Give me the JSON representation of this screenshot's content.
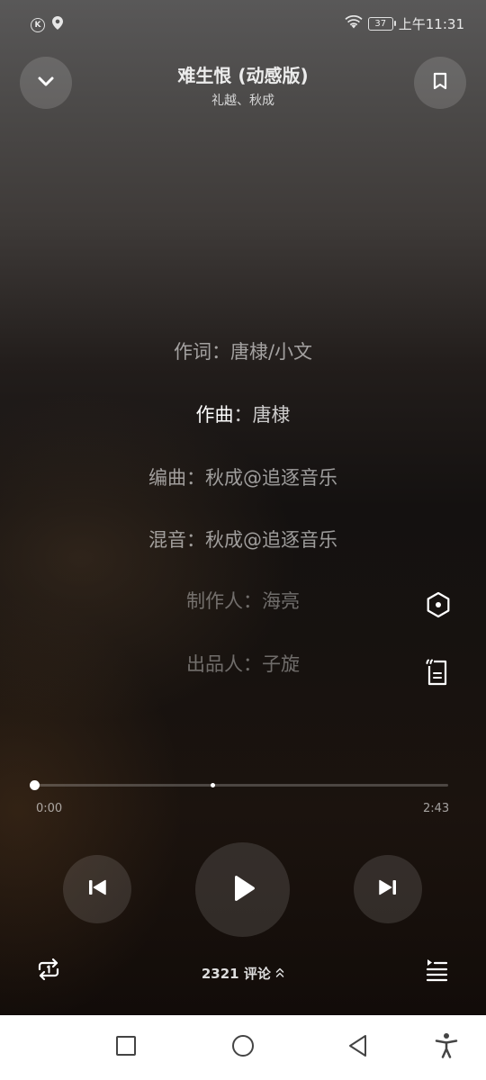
{
  "status_bar": {
    "time": "上午11:31",
    "battery": "37",
    "left_icons": [
      "k-badge-icon",
      "location-icon"
    ],
    "right_icons": [
      "wifi-icon",
      "battery-icon"
    ]
  },
  "header": {
    "title": "难生恨 (动感版)",
    "artist": "礼越、秋成",
    "collapse_icon": "chevron-down-icon",
    "bookmark_icon": "bookmark-icon"
  },
  "lyrics": [
    "作词：唐棣/小文",
    {
      "highlight": "作曲",
      "rest": "：唐棣"
    },
    "编曲：秋成@追逐音乐",
    "混音：秋成@追逐音乐",
    "制作人：海亮",
    "出品人：子旋"
  ],
  "side_icons": [
    "hexagon-effect-icon",
    "lyrics-translate-icon"
  ],
  "player": {
    "current_time": "0:00",
    "total_time": "2:43",
    "progress": 0.0,
    "controls": [
      "previous-icon",
      "play-icon",
      "next-icon"
    ]
  },
  "footer": {
    "repeat_icon": "repeat-icon",
    "comment_count": "2321",
    "comment_label": "评论",
    "playlist_icon": "playlist-icon"
  },
  "nav_bar": [
    "recent-apps-icon",
    "home-icon",
    "back-icon",
    "accessibility-icon"
  ],
  "colors": {
    "text_primary": "#ececec",
    "background_dark": "#141110",
    "nav_background": "#ffffff"
  }
}
